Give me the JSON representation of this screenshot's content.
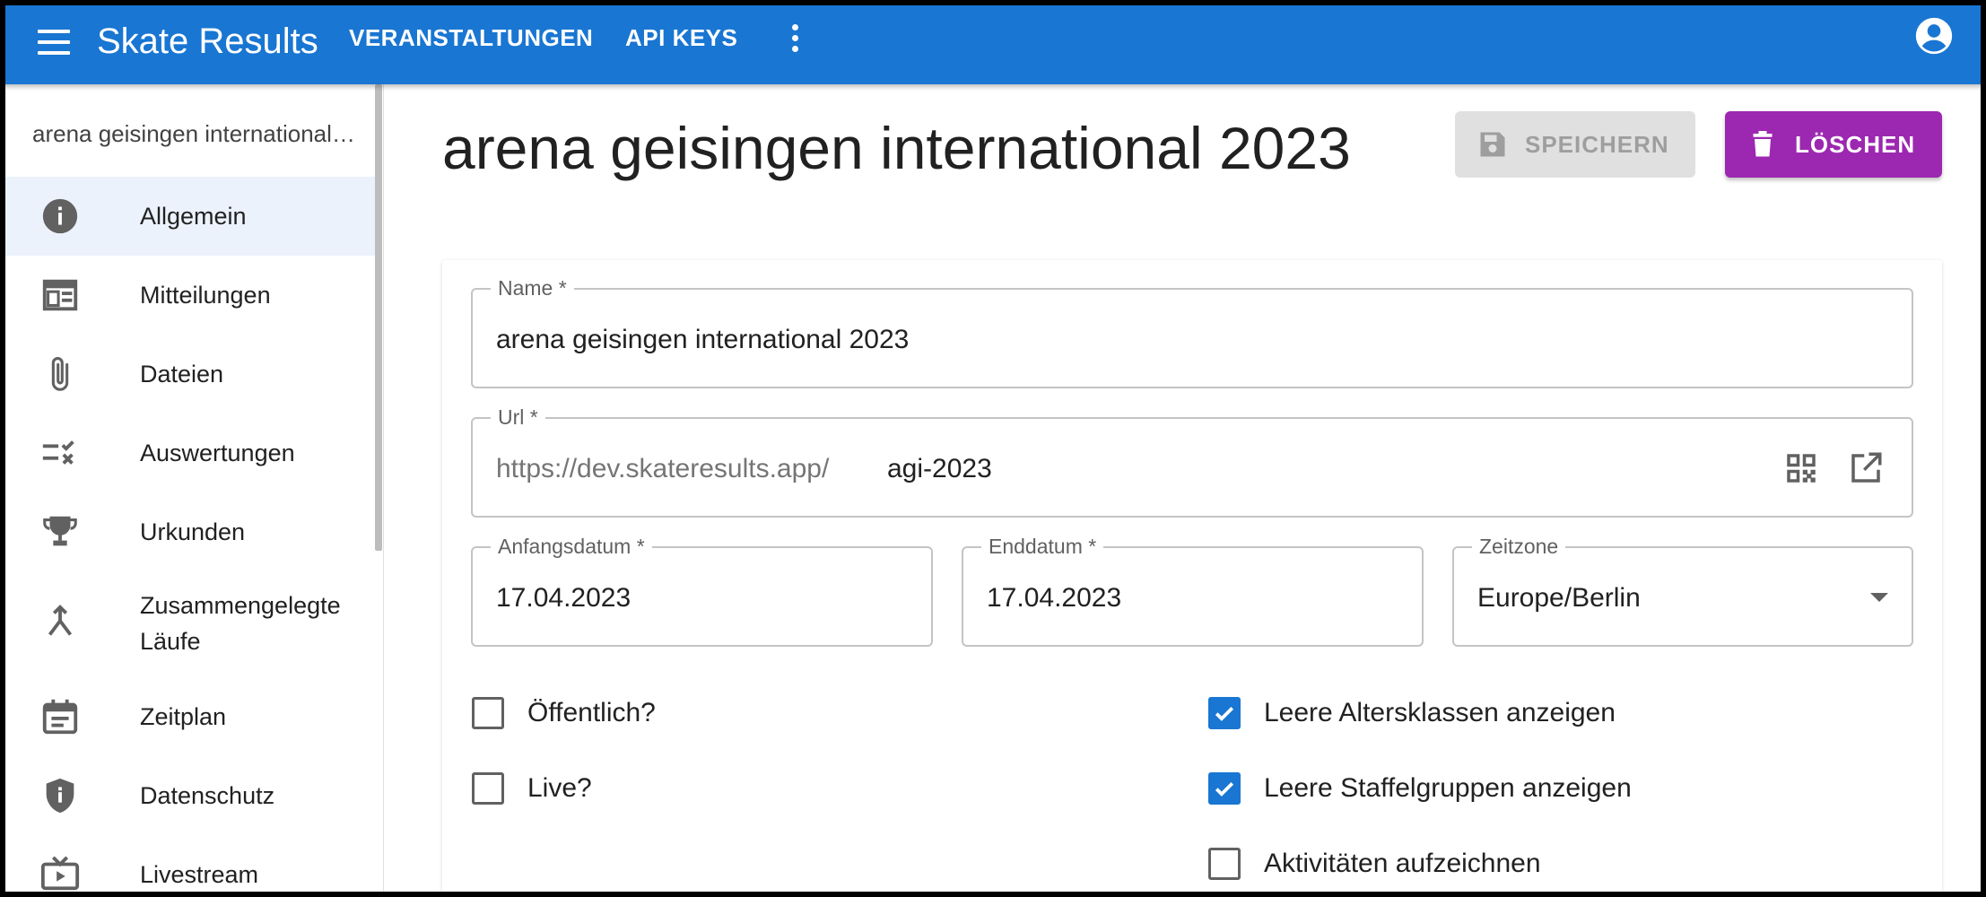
{
  "appbar": {
    "title": "Skate Results",
    "nav": [
      "VERANSTALTUNGEN",
      "API KEYS"
    ],
    "color": "#1976d2"
  },
  "sidebar": {
    "event_title": "arena geisingen international 2023",
    "items": [
      {
        "label": "Allgemein",
        "icon": "info-icon",
        "active": true
      },
      {
        "label": "Mitteilungen",
        "icon": "newspaper-icon"
      },
      {
        "label": "Dateien",
        "icon": "paperclip-icon"
      },
      {
        "label": "Auswertungen",
        "icon": "checklist-icon"
      },
      {
        "label": "Urkunden",
        "icon": "trophy-icon"
      },
      {
        "label": "Zusammengelegte",
        "label2": "Läufe",
        "icon": "merge-icon"
      },
      {
        "label": "Zeitplan",
        "icon": "calendar-icon"
      },
      {
        "label": "Datenschutz",
        "icon": "shield-icon"
      },
      {
        "label": "Livestream",
        "icon": "tv-icon"
      }
    ]
  },
  "main": {
    "title": "arena geisingen international 2023",
    "save_label": "SPEICHERN",
    "delete_label": "LÖSCHEN",
    "delete_color": "#9c27b0",
    "form": {
      "name_label": "Name *",
      "name_value": "arena geisingen international 2023",
      "url_label": "Url *",
      "url_prefix": "https://dev.skateresults.app/",
      "url_value": "agi-2023",
      "start_label": "Anfangsdatum *",
      "start_value": "17.04.2023",
      "end_label": "Enddatum *",
      "end_value": "17.04.2023",
      "tz_label": "Zeitzone",
      "tz_value": "Europe/Berlin"
    },
    "checkboxes": [
      {
        "label": "Öffentlich?",
        "checked": false
      },
      {
        "label": "Live?",
        "checked": false
      },
      {
        "label": "Leere Altersklassen anzeigen",
        "checked": true
      },
      {
        "label": "Leere Staffelgruppen anzeigen",
        "checked": true
      },
      {
        "label": "Aktivitäten aufzeichnen",
        "checked": false
      }
    ]
  }
}
